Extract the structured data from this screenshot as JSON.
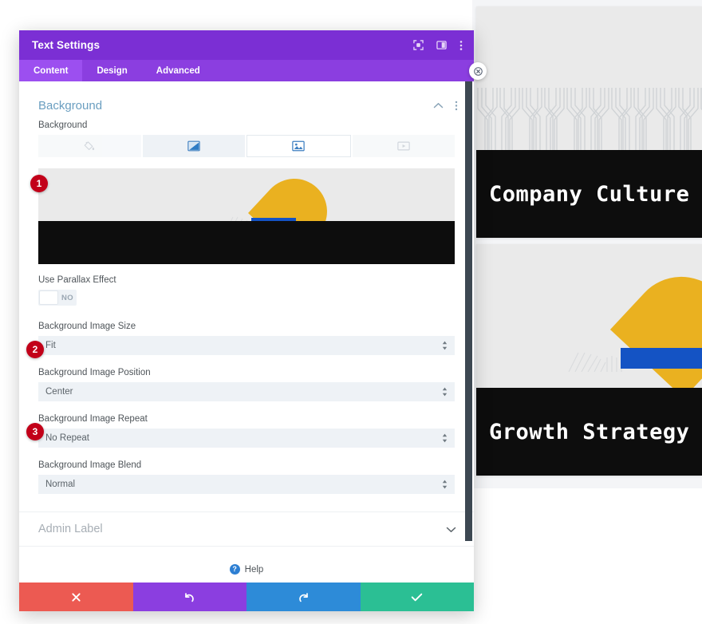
{
  "modal": {
    "title": "Text Settings",
    "header_icons": [
      {
        "name": "focus-target-icon",
        "glyph": "focus"
      },
      {
        "name": "panel-layout-icon",
        "glyph": "panel"
      },
      {
        "name": "more-options-icon",
        "glyph": "kebab"
      }
    ],
    "tabs": [
      {
        "label": "Content",
        "active": true
      },
      {
        "label": "Design",
        "active": false
      },
      {
        "label": "Advanced",
        "active": false
      }
    ],
    "section": {
      "title": "Background",
      "collapse_icon": "chevron-up-icon",
      "options_icon": "kebab-icon"
    },
    "background_field_label": "Background",
    "background_types": [
      {
        "name": "background-color-tab",
        "icon": "paint-bucket-icon",
        "active": false,
        "disabled": true
      },
      {
        "name": "background-gradient-tab",
        "icon": "gradient-icon",
        "active": false,
        "disabled": false
      },
      {
        "name": "background-image-tab",
        "icon": "image-icon",
        "active": true,
        "disabled": false
      },
      {
        "name": "background-video-tab",
        "icon": "video-icon",
        "active": false,
        "disabled": true
      }
    ],
    "parallax": {
      "label": "Use Parallax Effect",
      "value": "NO"
    },
    "selects": [
      {
        "name": "background-image-size",
        "label": "Background Image Size",
        "value": "Fit"
      },
      {
        "name": "background-image-position",
        "label": "Background Image Position",
        "value": "Center"
      },
      {
        "name": "background-image-repeat",
        "label": "Background Image Repeat",
        "value": "No Repeat"
      },
      {
        "name": "background-image-blend",
        "label": "Background Image Blend",
        "value": "Normal"
      }
    ],
    "admin_label": {
      "label": "Admin Label",
      "chevron": "chevron-down-icon"
    },
    "help": {
      "label": "Help",
      "icon_glyph": "?"
    },
    "footer_buttons": [
      {
        "name": "cancel-button",
        "glyph": "✖",
        "color": "#ec5a52"
      },
      {
        "name": "undo-button",
        "glyph": "↺",
        "color": "#8b3ee0"
      },
      {
        "name": "redo-button",
        "glyph": "↻",
        "color": "#2d8bd8"
      },
      {
        "name": "save-button",
        "glyph": "✔",
        "color": "#2bbf94"
      }
    ]
  },
  "preview": {
    "close_button": "close-icon",
    "cards": [
      {
        "title": "Company Culture",
        "style": "pattern"
      },
      {
        "title": "Growth Strategy",
        "style": "sun"
      }
    ]
  },
  "annotations": [
    {
      "number": "1"
    },
    {
      "number": "2"
    },
    {
      "number": "3"
    }
  ],
  "colors": {
    "header_purple": "#7b2fd4",
    "tabbar_purple": "#8b3ee0",
    "tab_active_purple": "#9c4ff0",
    "section_heading_blue": "#6a9ec0",
    "badge_red": "#c20019",
    "image_yellow": "#eab120",
    "image_blue": "#1453c4",
    "image_black": "#0d0d0d"
  }
}
